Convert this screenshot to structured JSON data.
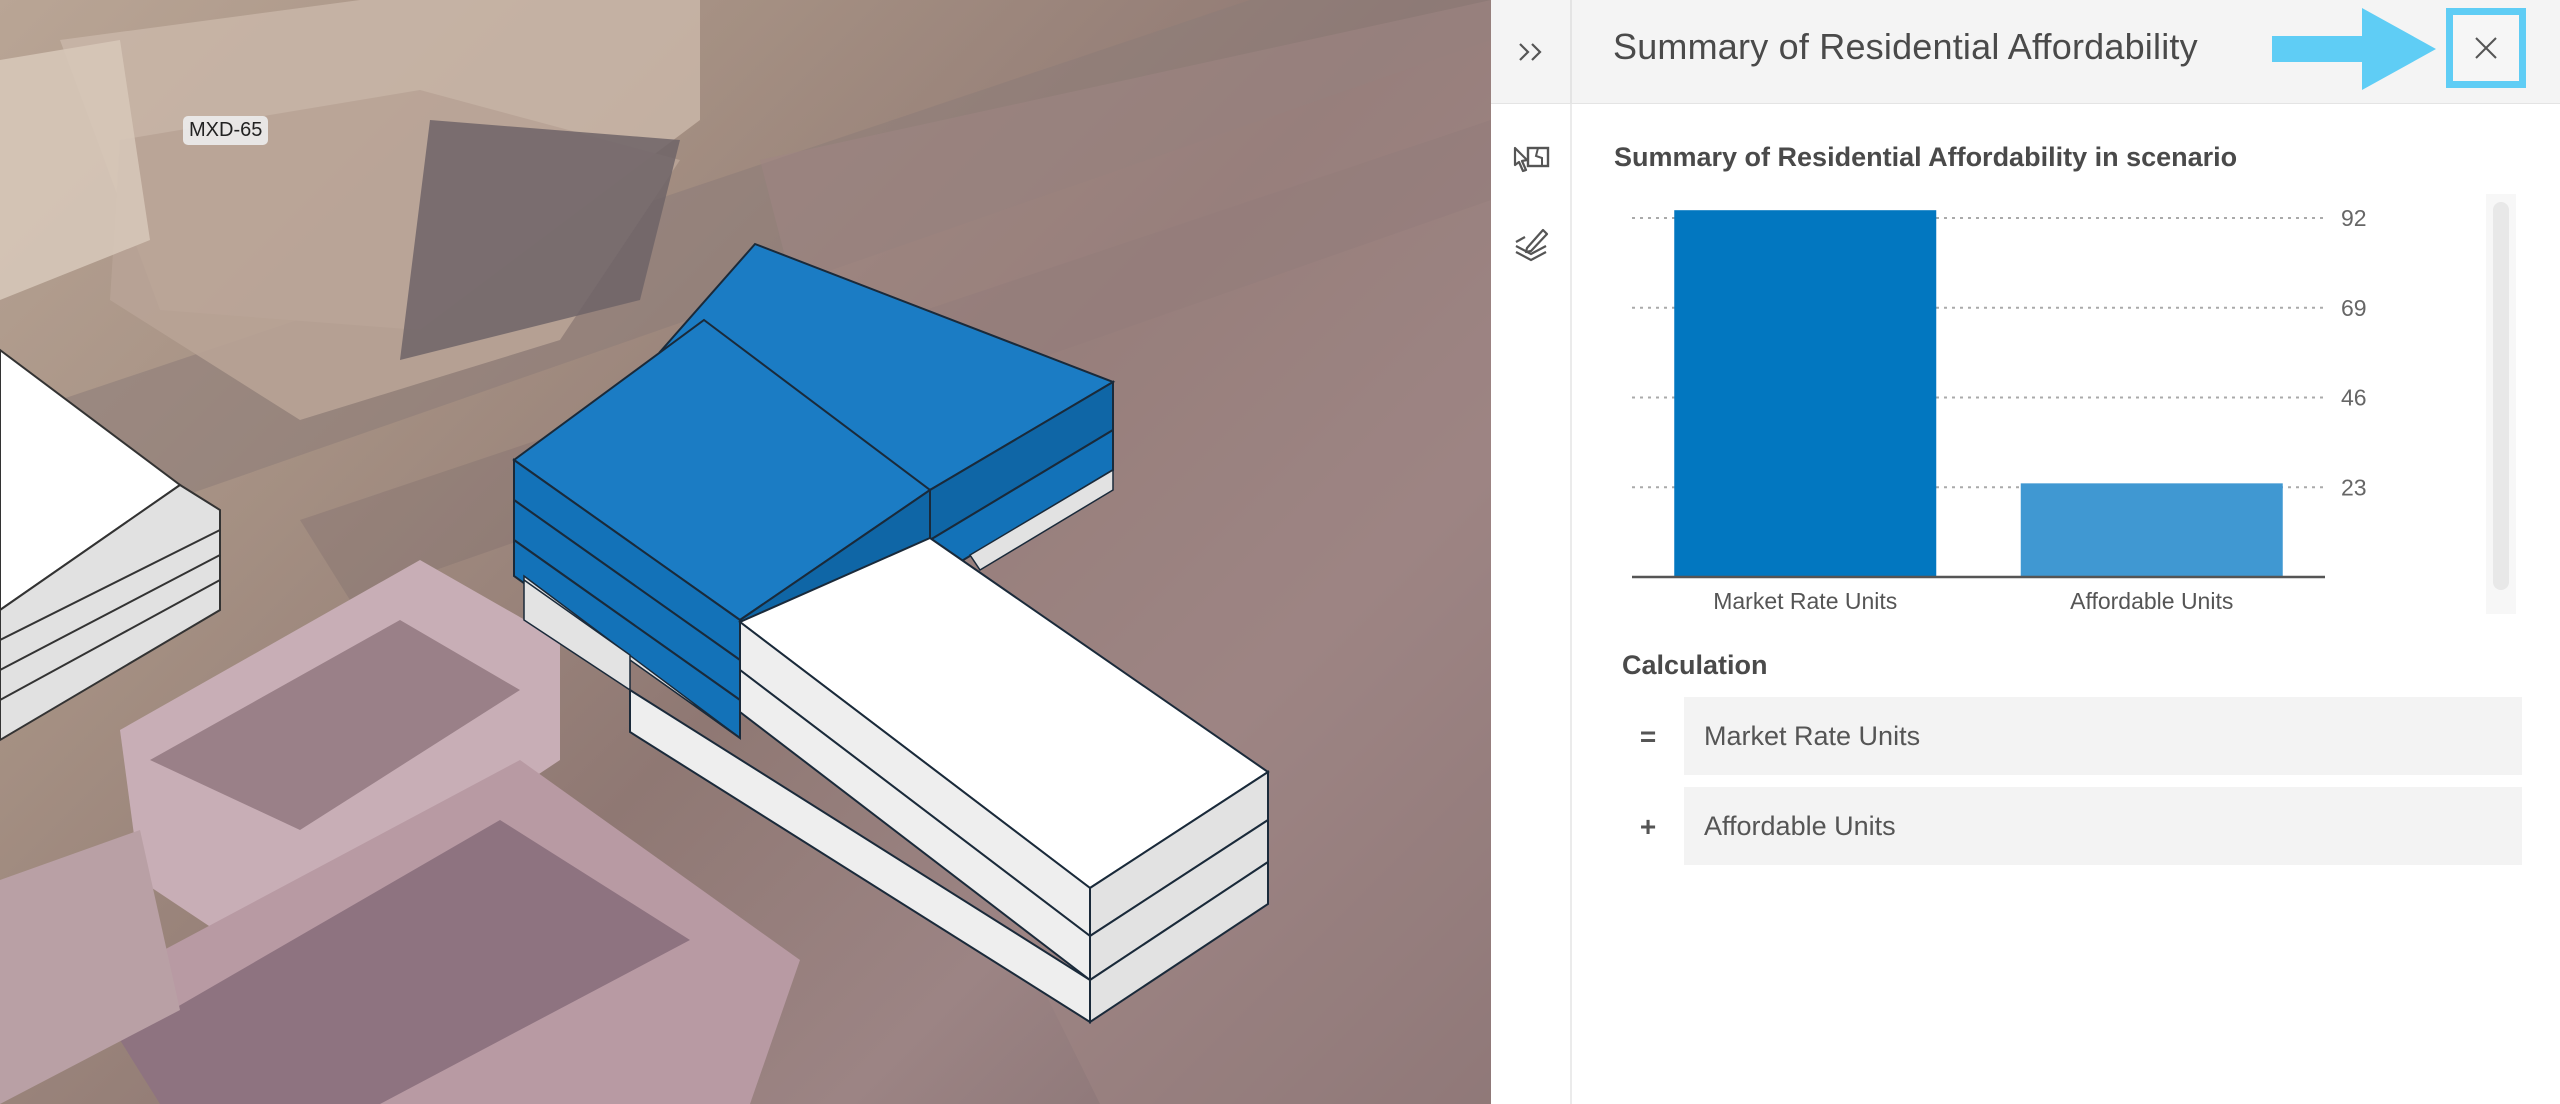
{
  "map": {
    "parcel_label": "MXD-65",
    "colors": {
      "proposed_blue": "#1b7cc4",
      "proposed_blue_dark": "#0f66a6",
      "building_white": "#fdfdfd",
      "building_side": "#dedede"
    }
  },
  "panel": {
    "title": "Summary of Residential Affordability",
    "expand_icon": "double-chevron-right-icon",
    "close_icon": "close-icon",
    "rail_icons": [
      "select-features-icon",
      "edit-layers-icon"
    ],
    "annotation": {
      "arrow_color": "#5fcdf5",
      "highlight_color": "#5fcdf5"
    }
  },
  "chart_data": {
    "type": "bar",
    "title": "Summary of Residential Affordability in scenario",
    "categories": [
      "Market Rate Units",
      "Affordable Units"
    ],
    "values": [
      94,
      24
    ],
    "colors": [
      "#0277c0",
      "#4098d2"
    ],
    "y_ticks": [
      23,
      46,
      69,
      92
    ],
    "ylim": [
      0,
      92
    ],
    "y_axis_position": "right",
    "grid": "dotted horizontal",
    "xlabel": "",
    "ylabel": ""
  },
  "calculation": {
    "title": "Calculation",
    "rows": [
      {
        "operator": "=",
        "field": "Market Rate Units"
      },
      {
        "operator": "+",
        "field": "Affordable Units"
      }
    ]
  }
}
